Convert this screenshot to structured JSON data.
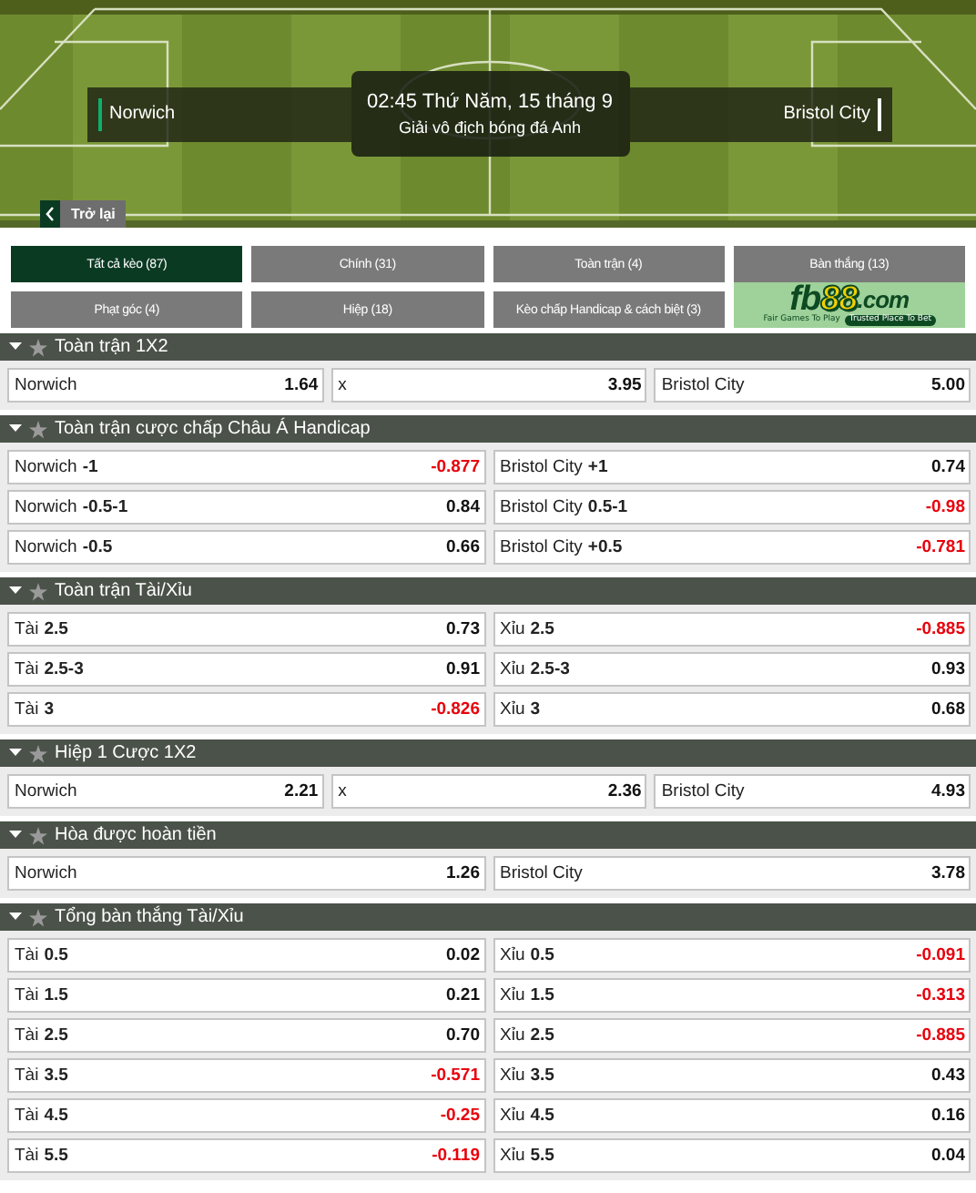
{
  "match": {
    "home": "Norwich",
    "away": "Bristol City",
    "time": "02:45 Thứ Năm, 15 tháng 9",
    "league": "Giải vô địch bóng đá Anh",
    "back": "Trở lại"
  },
  "tabs": [
    {
      "label": "Tất cả kèo (87)",
      "selected": true
    },
    {
      "label": "Chính (31)",
      "selected": false
    },
    {
      "label": "Toàn trận (4)",
      "selected": false
    },
    {
      "label": "Bàn thắng (13)",
      "selected": false
    },
    {
      "label": "Phạt góc (4)",
      "selected": false
    },
    {
      "label": "Hiệp (18)",
      "selected": false
    },
    {
      "label": "Kèo chấp Handicap & cách biệt (3)",
      "selected": false
    }
  ],
  "banner": {
    "logo_fb": "fb",
    "logo_88": "88",
    "logo_com": ".com",
    "tagline_left": "Fair Games To Play",
    "tagline_right": "Trusted Place To Bet"
  },
  "sections": [
    {
      "title": "Toàn trận 1X2",
      "rows": [
        [
          {
            "name": "Norwich",
            "odds": "1.64",
            "negative": false
          },
          {
            "name": "x",
            "odds": "3.95",
            "negative": false
          },
          {
            "name": "Bristol City",
            "odds": "5.00",
            "negative": false
          }
        ]
      ]
    },
    {
      "title": "Toàn trận cược chấp Châu Á Handicap",
      "rows": [
        [
          {
            "name": "Norwich",
            "line": "-1",
            "odds": "-0.877",
            "negative": true
          },
          {
            "name": "Bristol City",
            "line": "+1",
            "odds": "0.74",
            "negative": false
          }
        ],
        [
          {
            "name": "Norwich",
            "line": "-0.5-1",
            "odds": "0.84",
            "negative": false
          },
          {
            "name": "Bristol City",
            "line": "0.5-1",
            "odds": "-0.98",
            "negative": true
          }
        ],
        [
          {
            "name": "Norwich",
            "line": "-0.5",
            "odds": "0.66",
            "negative": false
          },
          {
            "name": "Bristol City",
            "line": "+0.5",
            "odds": "-0.781",
            "negative": true
          }
        ]
      ]
    },
    {
      "title": "Toàn trận Tài/Xỉu",
      "rows": [
        [
          {
            "name": "Tài",
            "line": "2.5",
            "odds": "0.73",
            "negative": false
          },
          {
            "name": "Xỉu",
            "line": "2.5",
            "odds": "-0.885",
            "negative": true
          }
        ],
        [
          {
            "name": "Tài",
            "line": "2.5-3",
            "odds": "0.91",
            "negative": false
          },
          {
            "name": "Xỉu",
            "line": "2.5-3",
            "odds": "0.93",
            "negative": false
          }
        ],
        [
          {
            "name": "Tài",
            "line": "3",
            "odds": "-0.826",
            "negative": true
          },
          {
            "name": "Xỉu",
            "line": "3",
            "odds": "0.68",
            "negative": false
          }
        ]
      ]
    },
    {
      "title": "Hiệp 1 Cược 1X2",
      "rows": [
        [
          {
            "name": "Norwich",
            "odds": "2.21",
            "negative": false
          },
          {
            "name": "x",
            "odds": "2.36",
            "negative": false
          },
          {
            "name": "Bristol City",
            "odds": "4.93",
            "negative": false
          }
        ]
      ]
    },
    {
      "title": "Hòa được hoàn tiền",
      "rows": [
        [
          {
            "name": "Norwich",
            "odds": "1.26",
            "negative": false
          },
          {
            "name": "Bristol City",
            "odds": "3.78",
            "negative": false
          }
        ]
      ]
    },
    {
      "title": "Tổng bàn thắng Tài/Xỉu",
      "rows": [
        [
          {
            "name": "Tài",
            "line": "0.5",
            "odds": "0.02",
            "negative": false
          },
          {
            "name": "Xỉu",
            "line": "0.5",
            "odds": "-0.091",
            "negative": true
          }
        ],
        [
          {
            "name": "Tài",
            "line": "1.5",
            "odds": "0.21",
            "negative": false
          },
          {
            "name": "Xỉu",
            "line": "1.5",
            "odds": "-0.313",
            "negative": true
          }
        ],
        [
          {
            "name": "Tài",
            "line": "2.5",
            "odds": "0.70",
            "negative": false
          },
          {
            "name": "Xỉu",
            "line": "2.5",
            "odds": "-0.885",
            "negative": true
          }
        ],
        [
          {
            "name": "Tài",
            "line": "3.5",
            "odds": "-0.571",
            "negative": true
          },
          {
            "name": "Xỉu",
            "line": "3.5",
            "odds": "0.43",
            "negative": false
          }
        ],
        [
          {
            "name": "Tài",
            "line": "4.5",
            "odds": "-0.25",
            "negative": true
          },
          {
            "name": "Xỉu",
            "line": "4.5",
            "odds": "0.16",
            "negative": false
          }
        ],
        [
          {
            "name": "Tài",
            "line": "5.5",
            "odds": "-0.119",
            "negative": true
          },
          {
            "name": "Xỉu",
            "line": "5.5",
            "odds": "0.04",
            "negative": false
          }
        ]
      ]
    }
  ]
}
